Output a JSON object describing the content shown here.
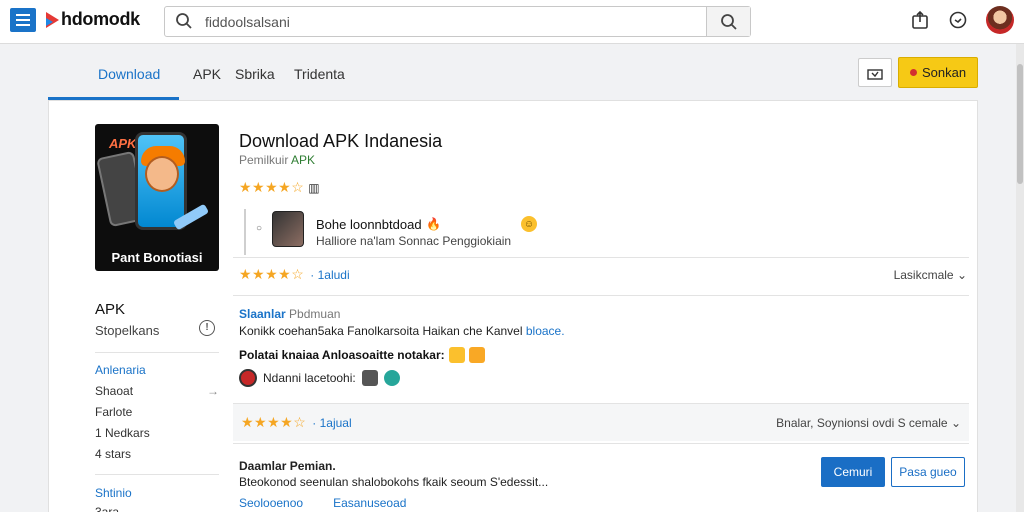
{
  "header": {
    "logo_text": "hdomodk",
    "search_value": "fiddoolsalsani",
    "menu_icon": "hamburger-icon",
    "search_icon": "search-icon",
    "share_icon": "share-icon",
    "chat_icon": "chat-icon"
  },
  "tabs": [
    {
      "label": "Download"
    },
    {
      "label": "APK"
    },
    {
      "label": "Sbrika"
    },
    {
      "label": "Tridenta"
    }
  ],
  "actions": {
    "install_label": "Sonkan"
  },
  "app": {
    "icon_tag": "APK",
    "icon_label": "Pant Bonotiasi",
    "title": "Download APK Indanesia",
    "developer_prefix": "Pemilkuir",
    "developer_link": "APK",
    "stars": "★★★★☆",
    "badge": "▥"
  },
  "promo": {
    "bullet": "○",
    "title": "Bohe loonnbtdoad",
    "fire": "🔥",
    "subtitle": "Halliore na'lam Sonnac Penggiokiain",
    "smile": "☺"
  },
  "reviews_bar_1": {
    "stars": "★★★★☆",
    "count": "· 1aludi",
    "sort": "Lasikcmale"
  },
  "review": {
    "author": "Slaanlar",
    "meta": "Pbdmuan",
    "body": "Konikk coehan5aka Fanolkarsoita Haikan che Kanvel",
    "body_link": "bloace.",
    "bold_line": "Polatai knaiaa Anloasoaitte notakar:",
    "line3": "Ndanni lacetoohi:"
  },
  "reviews_bar_2": {
    "stars": "★★★★☆",
    "count": "· 1ajual",
    "sort": "Bnalar, Soynionsi ovdi S cemale"
  },
  "description": {
    "title": "Daamlar Pemian.",
    "body": "Bteokonod seenulan shalobokohs fkaik seoum S'edessit...",
    "link1": "Seolooenoo",
    "link2": "Easanuseoad",
    "primary_btn": "Cemuri",
    "outline_btn": "Pasa gueo"
  },
  "sidebar": {
    "title": "APK",
    "subtitle": "Stopelkans",
    "info": "!",
    "items": [
      {
        "label": "Anlenaria"
      },
      {
        "label": "Shaoat"
      },
      {
        "label": "Farlote"
      },
      {
        "label": "1 Nedkars"
      },
      {
        "label": "4 stars"
      }
    ],
    "bottom_link": "Shtinio",
    "bottom_text": "3ara"
  }
}
